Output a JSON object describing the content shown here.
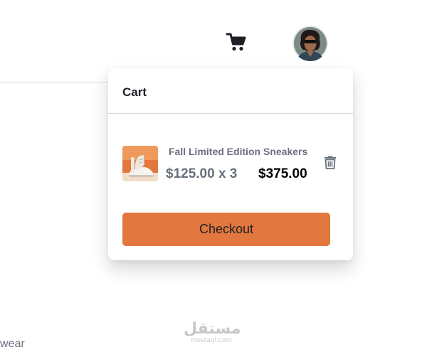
{
  "header": {
    "cart_icon": "cart-icon",
    "avatar_icon": "user-avatar"
  },
  "cart": {
    "title": "Cart",
    "items": [
      {
        "name": "Fall Limited Edition Sneakers",
        "unit_calc": "$125.00 x 3",
        "total": "$375.00",
        "thumbnail_icon": "sneaker-thumbnail",
        "delete_icon": "trash-icon"
      }
    ],
    "checkout_label": "Checkout"
  },
  "nav_fragment": "wear",
  "watermark": {
    "arabic": "مستقل",
    "latin": "mostaql.com"
  },
  "colors": {
    "accent": "#e2773f",
    "text_dark": "#1d2026",
    "text_gray": "#69707d",
    "divider": "#d9dadd"
  }
}
